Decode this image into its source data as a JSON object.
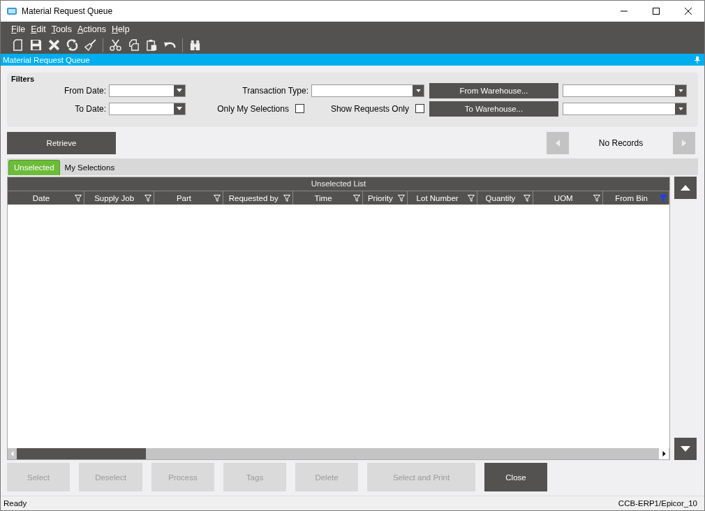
{
  "window": {
    "title": "Material Request Queue"
  },
  "menu": [
    "File",
    "Edit",
    "Tools",
    "Actions",
    "Help"
  ],
  "panel_title": "Material Request Queue",
  "filters": {
    "title": "Filters",
    "from_date_label": "From Date:",
    "to_date_label": "To Date:",
    "transaction_type_label": "Transaction Type:",
    "only_my_selections": {
      "label": "Only My Selections",
      "checked": false
    },
    "show_requests_only": {
      "label": "Show Requests Only",
      "checked": false
    },
    "from_warehouse_button": "From Warehouse...",
    "to_warehouse_button": "To Warehouse..."
  },
  "retrieve_button": "Retrieve",
  "navigator": {
    "text": "No Records"
  },
  "tabs": [
    {
      "label": "Unselected",
      "selected": true
    },
    {
      "label": "My Selections",
      "selected": false
    }
  ],
  "grid": {
    "title": "Unselected List",
    "columns": [
      {
        "label": "Date",
        "filter_active": false
      },
      {
        "label": "Supply Job",
        "filter_active": false
      },
      {
        "label": "Part",
        "filter_active": false
      },
      {
        "label": "Requested by",
        "filter_active": false
      },
      {
        "label": "Time",
        "filter_active": false
      },
      {
        "label": "Priority",
        "filter_active": false
      },
      {
        "label": "Lot Number",
        "filter_active": false
      },
      {
        "label": "Quantity",
        "filter_active": false
      },
      {
        "label": "UOM",
        "filter_active": false
      },
      {
        "label": "From Bin",
        "filter_active": true
      }
    ]
  },
  "buttons": [
    {
      "label": "Select",
      "disabled": true
    },
    {
      "label": "Deselect",
      "disabled": true
    },
    {
      "label": "Process",
      "disabled": true
    },
    {
      "label": "Tags",
      "disabled": true
    },
    {
      "label": "Delete",
      "disabled": true
    },
    {
      "label": "Select and Print",
      "disabled": true
    },
    {
      "label": "Close",
      "disabled": false
    }
  ],
  "status_bar": {
    "left": "Ready",
    "right": "CCB-ERP1/Epicor_10"
  }
}
